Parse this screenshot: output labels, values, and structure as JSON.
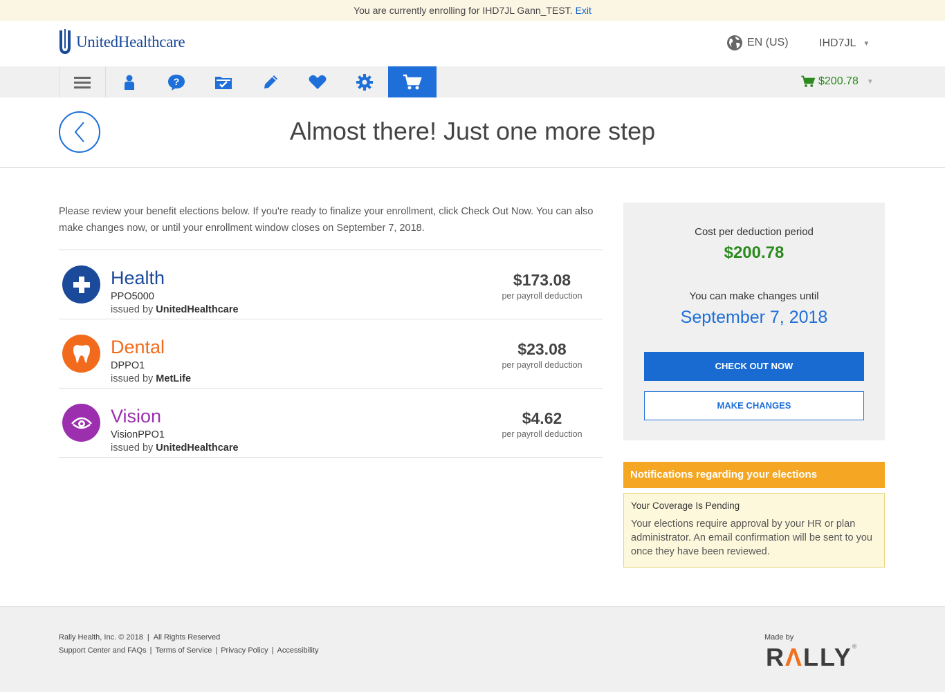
{
  "banner": {
    "text": "You are currently enrolling for IHD7JL Gann_TEST.",
    "exit_label": "Exit"
  },
  "brand": {
    "logo_text": "UnitedHealthcare"
  },
  "header_bar": {
    "language": "EN (US)",
    "user": "IHD7JL"
  },
  "nav": {
    "items": [
      "menu-icon",
      "person-icon",
      "help-icon",
      "folder-check-icon",
      "pencil-icon",
      "heart-icon",
      "gear-icon",
      "cart-icon"
    ],
    "active": "cart-icon",
    "cart_total": "$200.78"
  },
  "page": {
    "title": "Almost there! Just one more step"
  },
  "intro": "Please review your benefit elections below. If you're ready to finalize your enrollment, click Check Out Now. You can also make changes now, or until your enrollment window closes on September 7, 2018.",
  "plans": [
    {
      "name": "Health",
      "code": "PPO5000",
      "issuer_prefix": "issued by",
      "issuer": "UnitedHealthcare",
      "price": "$173.08",
      "price_sub": "per payroll deduction",
      "color": "#1b4a9b",
      "icon": "medical-cross-icon"
    },
    {
      "name": "Dental",
      "code": "DPPO1",
      "issuer_prefix": "issued by",
      "issuer": "MetLife",
      "price": "$23.08",
      "price_sub": "per payroll deduction",
      "color": "#f26b1d",
      "icon": "tooth-icon"
    },
    {
      "name": "Vision",
      "code": "VisionPPO1",
      "issuer_prefix": "issued by",
      "issuer": "UnitedHealthcare",
      "price": "$4.62",
      "price_sub": "per payroll deduction",
      "color": "#9b2fae",
      "icon": "eye-icon"
    }
  ],
  "summary": {
    "cost_label": "Cost per deduction period",
    "cost": "$200.78",
    "until_label": "You can make changes until",
    "until_date": "September 7, 2018",
    "checkout_label": "CHECK OUT NOW",
    "changes_label": "MAKE CHANGES"
  },
  "notifications": {
    "header": "Notifications regarding your elections",
    "title": "Your Coverage Is Pending",
    "text": "Your elections require approval by your HR or plan administrator. An email confirmation will be sent to you once they have been reviewed."
  },
  "footer": {
    "copyright": "Rally Health, Inc. © 2018",
    "rights": "All Rights Reserved",
    "links": [
      "Support Center and FAQs",
      "Terms of Service",
      "Privacy Policy",
      "Accessibility"
    ],
    "made_by": "Made by",
    "rally": "RALLY"
  },
  "colors": {
    "accent": "#1e6fd9",
    "money": "#2b8a1e",
    "notification": "#f5a623"
  }
}
